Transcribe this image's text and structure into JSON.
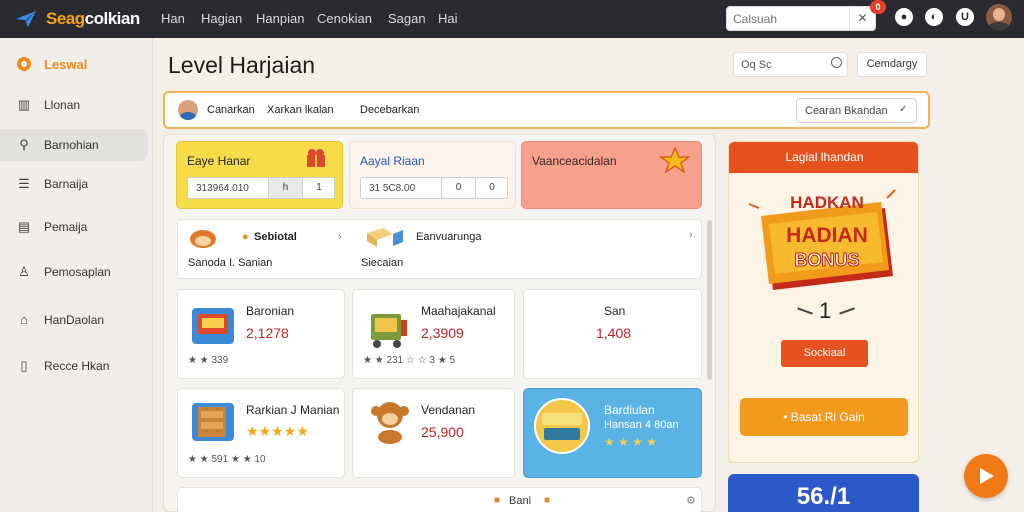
{
  "header": {
    "logo_a": "Seag",
    "logo_b": "colkian",
    "nav": [
      "Han",
      "Hagian",
      "Hanpian",
      "Cenokian",
      "Sagan",
      "Hai"
    ],
    "search_placeholder": "Calsuah",
    "notif_count": "0",
    "icon_names": [
      "games-icon",
      "chat-icon",
      "user-icon"
    ]
  },
  "sidebar": {
    "items": [
      {
        "label": "Leswal",
        "icon": "level-dot-icon"
      },
      {
        "label": "Llonan",
        "icon": "bars-icon"
      },
      {
        "label": "Barnohian",
        "icon": "search-icon"
      },
      {
        "label": "Barnaija",
        "icon": "list-icon"
      },
      {
        "label": "Pemaija",
        "icon": "page-icon"
      },
      {
        "label": "Pemosaplan",
        "icon": "person-icon"
      },
      {
        "label": "HanDaolan",
        "icon": "home-icon"
      },
      {
        "label": "Recce Hkan",
        "icon": "doc-icon"
      }
    ]
  },
  "main": {
    "title": "Level Harjaian",
    "filter_value": "Oq Sc",
    "category_button": "Cemdargy"
  },
  "strip": {
    "t1": "Canarkan",
    "t2": "Xarkan lkalan",
    "t3": "Decebarkan",
    "select_value": "Cearan Bkandan"
  },
  "stats": [
    {
      "title": "Eaye Hanar",
      "value": "313964.010",
      "b1": "h",
      "b2": "1"
    },
    {
      "title": "Aayal Riaan",
      "value": "31 5C8.00",
      "b1": "0",
      "b2": "0"
    },
    {
      "title": "Vaanceacidalan",
      "value": "",
      "b1": "",
      "b2": ""
    }
  ],
  "row": {
    "c1_title": "Sebiotal",
    "c1_sub": "Sanoda I. Sanian",
    "c2_title": "Eanvuarunga",
    "c2_sub": "Siecaian"
  },
  "products": [
    {
      "name": "Baronian",
      "price": "2,1278",
      "rating": "★ ★ 339"
    },
    {
      "name": "Maahajakanal",
      "price": "2,3909",
      "rating": "★ ★ 231  ☆ ☆ 3 ★ 5"
    },
    {
      "name": "San",
      "price": "1,408",
      "rating": ""
    },
    {
      "name": "Rarkian J Manian",
      "price": "",
      "rating": "★ ★ 591   ★ ★ 10"
    },
    {
      "name": "Vendanan",
      "price": "25,900",
      "rating": ""
    },
    {
      "name": "Bardiulan",
      "sub": "Hansan 4 80an",
      "rating": "★ ★ ★ ★"
    }
  ],
  "bottom": {
    "label": "Bani"
  },
  "promo": {
    "header": "Lagial lhandan",
    "line1": "HADKAN",
    "line2": "HADIAN",
    "line3": "BONUS",
    "count": "1",
    "button": "Sockiaal",
    "cta": "• Basat Ri Gain",
    "score": "56./1"
  },
  "colors": {
    "accent": "#f08a1c",
    "topbar": "#2a2b30",
    "promo_red": "#e5521f",
    "price_red": "#b9232b"
  }
}
